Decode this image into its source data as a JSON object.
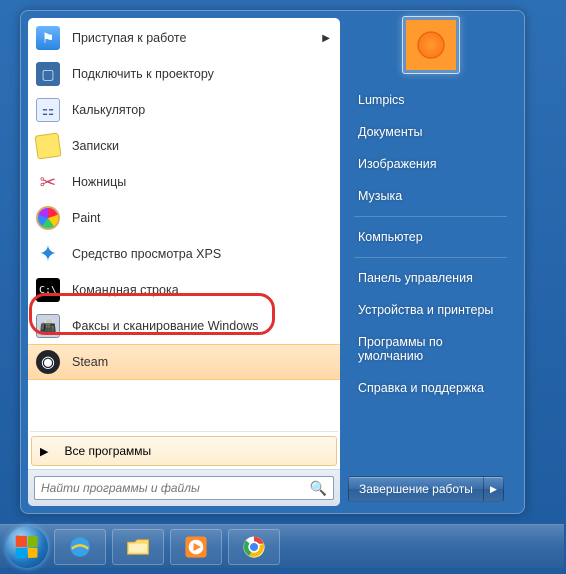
{
  "programs": [
    {
      "label": "Приступая к работе",
      "has_submenu": true
    },
    {
      "label": "Подключить к проектору"
    },
    {
      "label": "Калькулятор"
    },
    {
      "label": "Записки"
    },
    {
      "label": "Ножницы"
    },
    {
      "label": "Paint"
    },
    {
      "label": "Средство просмотра XPS"
    },
    {
      "label": "Командная строка"
    },
    {
      "label": "Факсы и сканирование Windows"
    },
    {
      "label": "Steam"
    }
  ],
  "all_programs": "Все программы",
  "search_placeholder": "Найти программы и файлы",
  "right_items": {
    "user": "Lumpics",
    "documents": "Документы",
    "pictures": "Изображения",
    "music": "Музыка",
    "computer": "Компьютер",
    "control_panel": "Панель управления",
    "devices": "Устройства и принтеры",
    "default_programs": "Программы по умолчанию",
    "help": "Справка и поддержка"
  },
  "shutdown_label": "Завершение работы"
}
